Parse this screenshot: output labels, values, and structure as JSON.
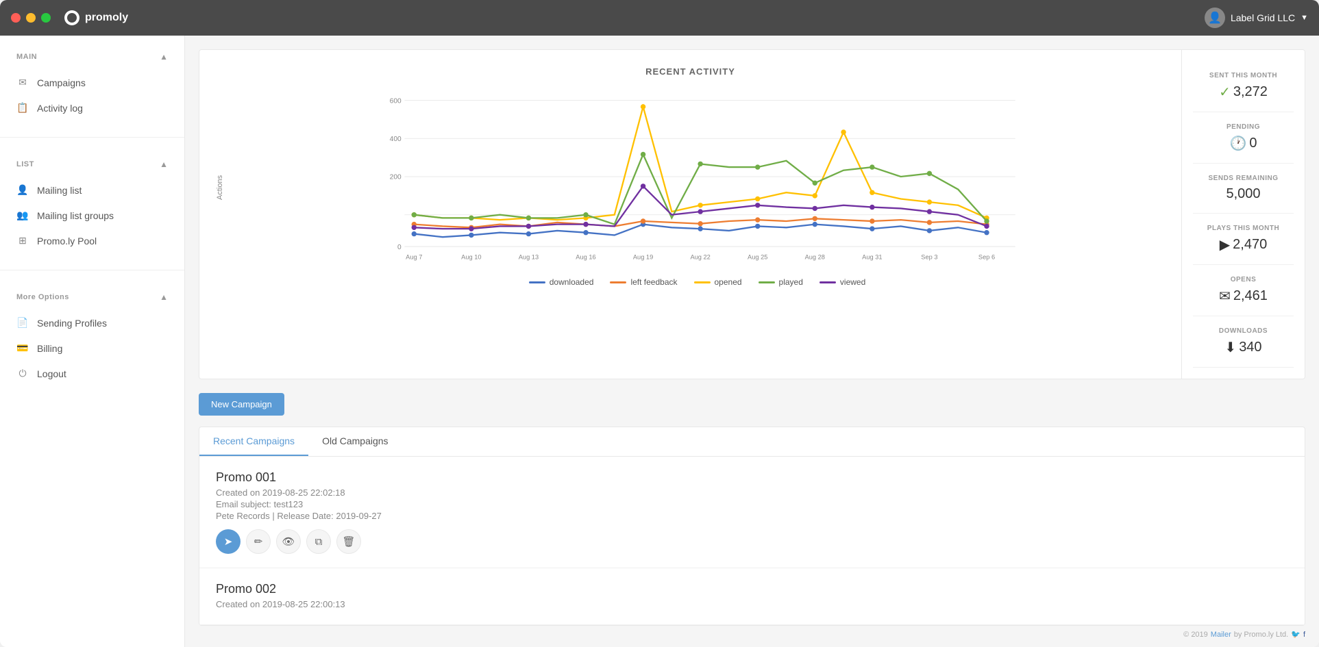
{
  "app": {
    "name": "promoly",
    "user": "Label Grid LLC"
  },
  "titlebar": {
    "traffic": [
      "red",
      "yellow",
      "green"
    ]
  },
  "sidebar": {
    "main_section": "MAIN",
    "list_section": "LIST",
    "more_section": "More Options",
    "items": {
      "campaigns": "Campaigns",
      "activity_log": "Activity log",
      "mailing_list": "Mailing list",
      "mailing_list_groups": "Mailing list groups",
      "promoly_pool": "Promo.ly Pool",
      "sending_profiles": "Sending Profiles",
      "billing": "Billing",
      "logout": "Logout"
    }
  },
  "chart": {
    "title": "RECENT ACTIVITY",
    "y_label": "Actions",
    "y_ticks": [
      "600",
      "400",
      "200",
      "0"
    ],
    "x_labels": [
      "Aug 7",
      "Aug 10",
      "Aug 13",
      "Aug 16",
      "Aug 19",
      "Aug 22",
      "Aug 25",
      "Aug 28",
      "Aug 31",
      "Sep 3",
      "Sep 6"
    ],
    "legend": [
      {
        "label": "downloaded",
        "color": "#4472c4"
      },
      {
        "label": "left feedback",
        "color": "#ed7d31"
      },
      {
        "label": "opened",
        "color": "#ffc000"
      },
      {
        "label": "played",
        "color": "#70ad47"
      },
      {
        "label": "viewed",
        "color": "#7030a0"
      }
    ]
  },
  "stats": {
    "sent_this_month_label": "SENT THIS MONTH",
    "sent_this_month_value": "3,272",
    "pending_label": "PENDING",
    "pending_value": "0",
    "sends_remaining_label": "SENDS REMAINING",
    "sends_remaining_value": "5,000",
    "plays_label": "PLAYS THIS MONTH",
    "plays_value": "2,470",
    "opens_label": "OPENS",
    "opens_value": "2,461",
    "downloads_label": "DOWNLOADS",
    "downloads_value": "340"
  },
  "campaigns": {
    "new_button": "New Campaign",
    "tab_recent": "Recent Campaigns",
    "tab_old": "Old Campaigns",
    "items": [
      {
        "name": "Promo 001",
        "created": "Created on 2019-08-25 22:02:18",
        "subject": "Email subject: test123",
        "release": "Pete Records | Release Date: 2019-09-27"
      },
      {
        "name": "Promo 002",
        "created": "Created on 2019-08-25 22:00:13",
        "subject": "",
        "release": ""
      }
    ]
  },
  "footer": {
    "copy": "© 2019",
    "mailer": "Mailer",
    "by": "by Promo.ly Ltd."
  }
}
